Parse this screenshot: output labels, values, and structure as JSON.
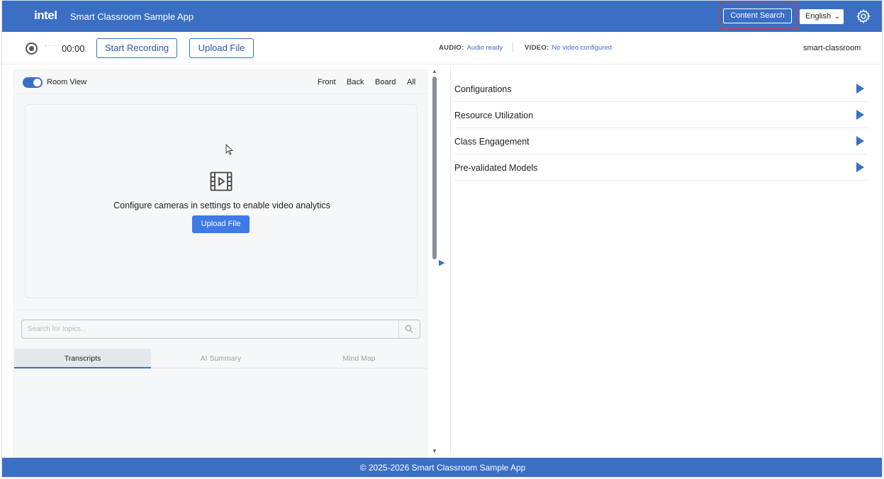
{
  "header": {
    "logo": "intel",
    "app_title": "Smart Classroom Sample App",
    "content_search_label": "Content Search",
    "language": "English",
    "settings_icon": "gear-icon"
  },
  "toolbar": {
    "timer": "00:00",
    "wave": "·····",
    "start_recording_label": "Start Recording",
    "upload_file_label": "Upload File",
    "audio_key": "AUDIO:",
    "audio_value": "Audio ready",
    "video_key": "VIDEO:",
    "video_value": "No video configured",
    "environment": "smart-classroom"
  },
  "room": {
    "toggle_label": "Room View",
    "toggle_on": true,
    "views": [
      "Front",
      "Back",
      "Board",
      "All"
    ],
    "message": "Configure cameras in settings to enable video analytics",
    "upload_label": "Upload File"
  },
  "lower": {
    "search_placeholder": "Search for topics...",
    "tabs": [
      "Transcripts",
      "AI Summary",
      "Mind Map"
    ],
    "active_tab": "Transcripts"
  },
  "sidebar": {
    "items": [
      {
        "label": "Configurations"
      },
      {
        "label": "Resource Utilization"
      },
      {
        "label": "Class Engagement"
      },
      {
        "label": "Pre-validated Models"
      }
    ]
  },
  "footer": {
    "text": "© 2025-2026 Smart Classroom Sample App"
  },
  "colors": {
    "brand": "#3a6fc4",
    "button": "#3f7ae6",
    "highlight": "#e2352d"
  }
}
